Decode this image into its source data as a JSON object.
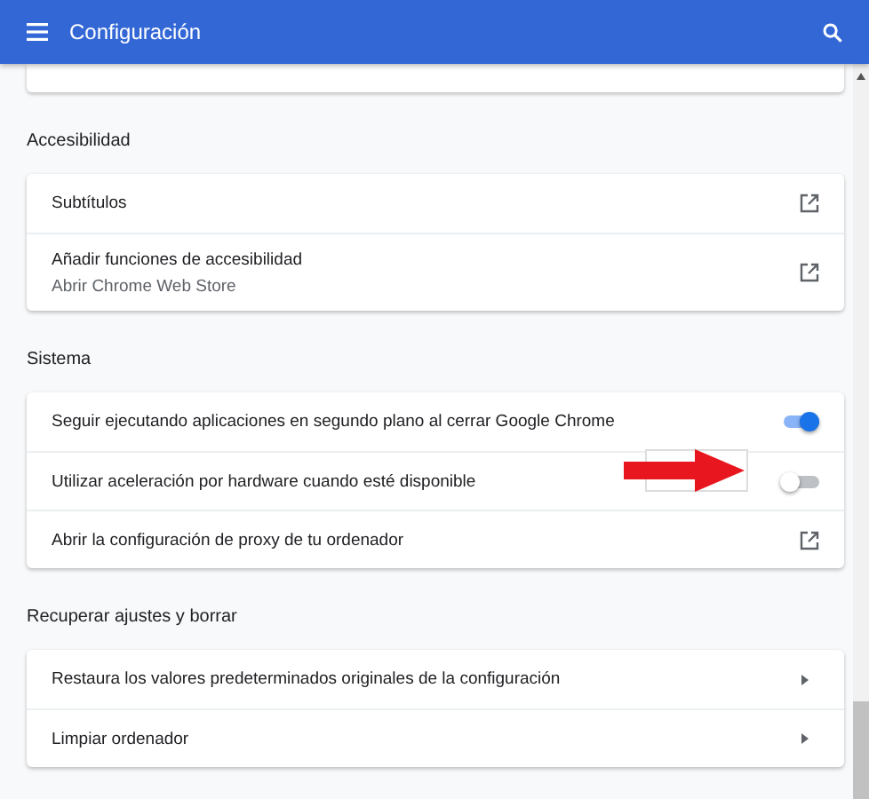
{
  "header": {
    "title": "Configuración"
  },
  "sections": [
    {
      "title": "Accesibilidad",
      "rows": [
        {
          "kind": "link",
          "label": "Subtítulos"
        },
        {
          "kind": "link",
          "label": "Añadir funciones de accesibilidad",
          "sublabel": "Abrir Chrome Web Store"
        }
      ]
    },
    {
      "title": "Sistema",
      "rows": [
        {
          "kind": "toggle",
          "label": "Seguir ejecutando aplicaciones en segundo plano al cerrar Google Chrome",
          "on": true
        },
        {
          "kind": "toggle",
          "label": "Utilizar aceleración por hardware cuando esté disponible",
          "on": false,
          "annotated": true
        },
        {
          "kind": "link",
          "label": "Abrir la configuración de proxy de tu ordenador"
        }
      ]
    },
    {
      "title": "Recuperar ajustes y borrar",
      "rows": [
        {
          "kind": "submenu",
          "label": "Restaura los valores predeterminados originales de la configuración"
        },
        {
          "kind": "submenu",
          "label": "Limpiar ordenador"
        }
      ]
    }
  ]
}
